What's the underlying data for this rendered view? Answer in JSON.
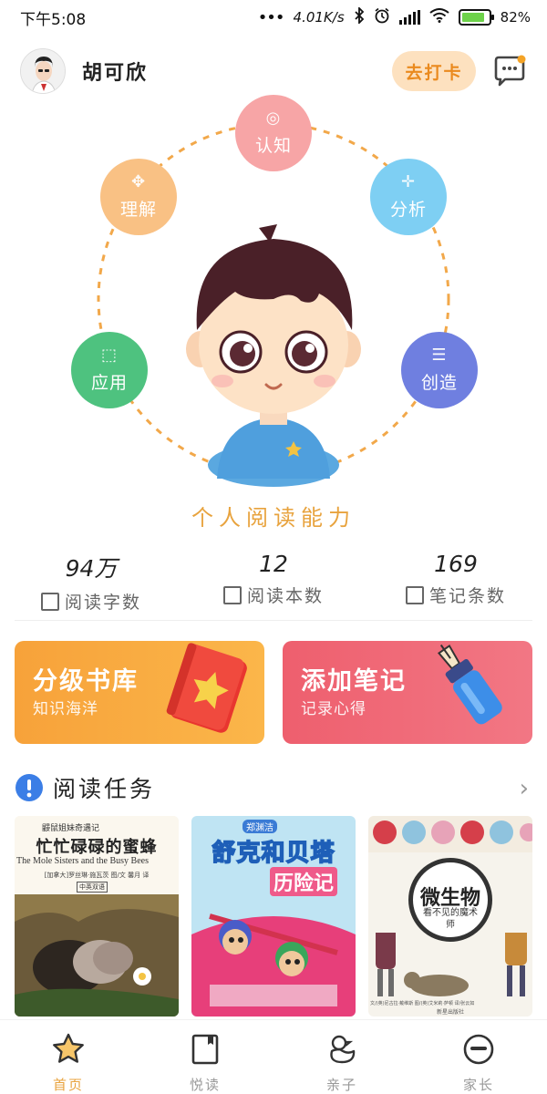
{
  "status_bar": {
    "time": "下午5:08",
    "net_speed": "4.01K/s",
    "battery": "82%"
  },
  "header": {
    "username": "胡可欣",
    "checkin_label": "去打卡"
  },
  "ability": {
    "title": "个人阅读能力",
    "nodes": [
      {
        "label": "认知",
        "color": "#f7a5a6"
      },
      {
        "label": "理解",
        "color": "#f9c184"
      },
      {
        "label": "分析",
        "color": "#7ecff3"
      },
      {
        "label": "应用",
        "color": "#4ec27f"
      },
      {
        "label": "创造",
        "color": "#6f7fe0"
      }
    ]
  },
  "stats": [
    {
      "value": "94万",
      "label": "阅读字数",
      "icon": "list-icon"
    },
    {
      "value": "12",
      "label": "阅读本数",
      "icon": "book-icon"
    },
    {
      "value": "169",
      "label": "笔记条数",
      "icon": "edit-icon"
    }
  ],
  "cards": [
    {
      "title": "分级书库",
      "subtitle": "知识海洋",
      "color": "#f9a63a"
    },
    {
      "title": "添加笔记",
      "subtitle": "记录心得",
      "color": "#ef6573"
    }
  ],
  "tasks": {
    "title": "阅读任务",
    "books": [
      {
        "series": "鼹鼠姐妹奇遇记",
        "title_cn": "忙忙碌碌的蜜蜂",
        "title_en": "The Mole Sisters and the Busy Bees",
        "credit": "[加拿大]罗丝琳·施瓦茨 图/文 馨月 译",
        "tag": "中英双语"
      },
      {
        "series": "郑渊洁",
        "title_cn": "舒克和贝塔",
        "subtitle": "历险记"
      },
      {
        "title_cn": "微生物",
        "subtitle": "看不见的魔术师",
        "credit": "文/(英)尼古拉·戴维斯  图/(英)艾米莉·萨顿  译/张云如",
        "publisher": "新星出版社"
      }
    ]
  },
  "nav": [
    {
      "label": "首页",
      "active": true
    },
    {
      "label": "悦读",
      "active": false
    },
    {
      "label": "亲子",
      "active": false
    },
    {
      "label": "家长",
      "active": false
    }
  ],
  "colors": {
    "accent": "#e8a33e",
    "orange_card": "#f9a63a",
    "red_card": "#ef6573"
  }
}
